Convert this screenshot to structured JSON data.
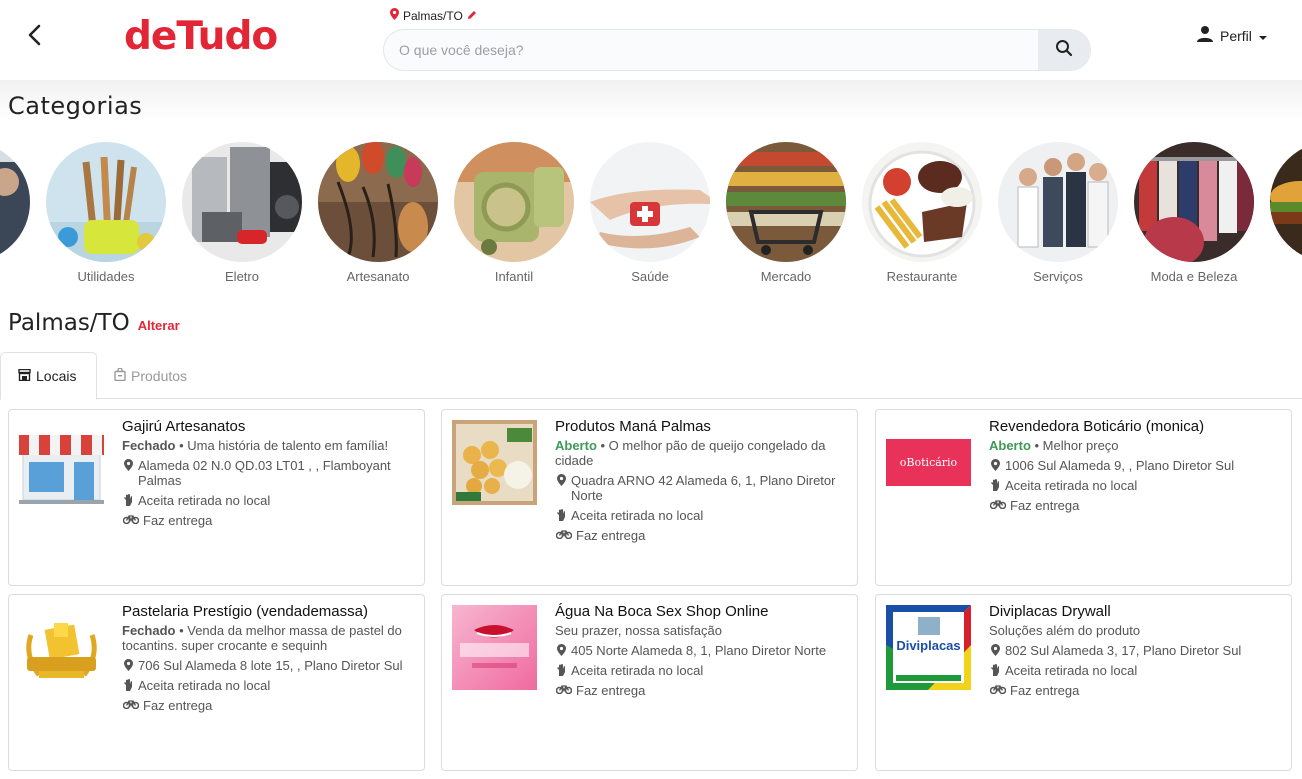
{
  "header": {
    "logo_text": "deTudo",
    "location": "Palmas/TO",
    "search_placeholder": "O que você deseja?",
    "profile_label": "Perfil"
  },
  "categories": {
    "title": "Categorias",
    "items": [
      {
        "label": "Utilidades"
      },
      {
        "label": "Eletro"
      },
      {
        "label": "Artesanato"
      },
      {
        "label": "Infantil"
      },
      {
        "label": "Saúde"
      },
      {
        "label": "Mercado"
      },
      {
        "label": "Restaurante"
      },
      {
        "label": "Serviços"
      },
      {
        "label": "Moda e Beleza"
      }
    ]
  },
  "city": {
    "name": "Palmas/TO",
    "change_label": "Alterar"
  },
  "tabs": [
    {
      "label": "Locais"
    },
    {
      "label": "Produtos"
    }
  ],
  "places": [
    {
      "title": "Gajirú Artesanatos",
      "status": "Fechado",
      "description": "Uma história de talento em família!",
      "address": "Alameda 02 N.0 QD.03 LT01 , , Flamboyant Palmas",
      "pickup": "Aceita retirada no local",
      "delivery": "Faz entrega"
    },
    {
      "title": "Produtos Maná Palmas",
      "status": "Aberto",
      "description": "O melhor pão de queijo congelado da cidade",
      "address": "Quadra ARNO 42 Alameda 6, 1, Plano Diretor Norte",
      "pickup": "Aceita retirada no local",
      "delivery": "Faz entrega"
    },
    {
      "title": "Revendedora Boticário (monica)",
      "status": "Aberto",
      "description": "Melhor preço",
      "address": "1006 Sul Alameda 9, , Plano Diretor Sul",
      "pickup": "Aceita retirada no local",
      "delivery": "Faz entrega",
      "logo_text": "oBoticário"
    },
    {
      "title": "Pastelaria Prestígio (vendademassa)",
      "status": "Fechado",
      "description": "Venda da melhor massa de pastel do tocantins. super crocante e sequinh",
      "address": "706 Sul Alameda 8 lote 15, , Plano Diretor Sul",
      "pickup": "Aceita retirada no local",
      "delivery": "Faz entrega"
    },
    {
      "title": "Água Na Boca Sex Shop Online",
      "status": "",
      "description": "Seu prazer, nossa satisfação",
      "address": "405 Norte Alameda 8, 1, Plano Diretor Norte",
      "pickup": "Aceita retirada no local",
      "delivery": "Faz entrega"
    },
    {
      "title": "Diviplacas Drywall",
      "status": "",
      "description": "Soluções além do produto",
      "address": "802 Sul Alameda 3, 17, Plano Diretor Sul",
      "pickup": "Aceita retirada no local",
      "delivery": "Faz entrega",
      "logo_text": "Diviplacas"
    }
  ],
  "colors": {
    "brand": "#e32636",
    "open": "#3f9a56"
  }
}
